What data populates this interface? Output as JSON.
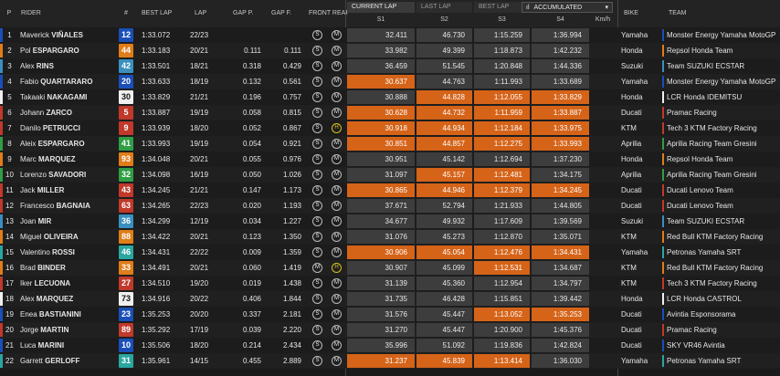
{
  "headers": {
    "pos": "P",
    "rider": "RIDER",
    "num": "#",
    "best": "BEST LAP",
    "lap": "LAP",
    "gapp": "GAP P.",
    "gapf": "GAP F.",
    "tyres": "FRONT REAR",
    "bike": "BIKE",
    "team": "TEAM"
  },
  "sector_tabs": {
    "current": "CURRENT LAP",
    "last": "LAST LAP",
    "best": "BEST LAP",
    "mode": "ACCUMULATED",
    "mode_prefix": "ıl"
  },
  "sector_labels": {
    "s1": "S1",
    "s2": "S2",
    "s3": "S3",
    "s4": "S4",
    "speed": "Km/h"
  },
  "rows": [
    {
      "pos": "1",
      "first": "Maverick",
      "last": "VIÑALES",
      "num": "12",
      "num_bg": "#1a4fb8",
      "num_fg": "#ffffff",
      "strip": "#1a4fb8",
      "best": "1:33.072",
      "lap": "22/23",
      "gapp": "",
      "gapf": "",
      "front": "S",
      "rear": "M",
      "s1": "32.411",
      "s2": "46.730",
      "s3": "1:15.259",
      "s4": "1:36.994",
      "o": [
        0,
        0,
        0,
        0
      ],
      "bike": "Yamaha",
      "team": "Monster Energy Yamaha MotoGP",
      "team_color": "#1a4fb8"
    },
    {
      "pos": "2",
      "first": "Pol",
      "last": "ESPARGARO",
      "num": "44",
      "num_bg": "#e07d18",
      "num_fg": "#ffffff",
      "strip": "#e07d18",
      "best": "1:33.183",
      "lap": "20/21",
      "gapp": "0.111",
      "gapf": "0.111",
      "front": "S",
      "rear": "M",
      "s1": "33.982",
      "s2": "49.399",
      "s3": "1:18.873",
      "s4": "1:42.232",
      "o": [
        0,
        0,
        0,
        0
      ],
      "bike": "Honda",
      "team": "Repsol Honda Team",
      "team_color": "#e07d18"
    },
    {
      "pos": "3",
      "first": "Alex",
      "last": "RINS",
      "num": "42",
      "num_bg": "#3a8fbf",
      "num_fg": "#ffffff",
      "strip": "#3a8fbf",
      "best": "1:33.501",
      "lap": "18/21",
      "gapp": "0.318",
      "gapf": "0.429",
      "front": "S",
      "rear": "M",
      "s1": "36.459",
      "s2": "51.545",
      "s3": "1:20.848",
      "s4": "1:44.336",
      "o": [
        0,
        0,
        0,
        0
      ],
      "bike": "Suzuki",
      "team": "Team SUZUKI ECSTAR",
      "team_color": "#3a8fbf"
    },
    {
      "pos": "4",
      "first": "Fabio",
      "last": "QUARTARARO",
      "num": "20",
      "num_bg": "#1a4fb8",
      "num_fg": "#ffffff",
      "strip": "#1a4fb8",
      "best": "1:33.633",
      "lap": "18/19",
      "gapp": "0.132",
      "gapf": "0.561",
      "front": "S",
      "rear": "M",
      "s1": "30.637",
      "s2": "44.763",
      "s3": "1:11.993",
      "s4": "1:33.689",
      "o": [
        1,
        0,
        0,
        0
      ],
      "bike": "Yamaha",
      "team": "Monster Energy Yamaha MotoGP",
      "team_color": "#1a4fb8"
    },
    {
      "pos": "5",
      "first": "Takaaki",
      "last": "NAKAGAMI",
      "num": "30",
      "num_bg": "#f0f0f0",
      "num_fg": "#111111",
      "strip": "#f0f0f0",
      "best": "1:33.829",
      "lap": "21/21",
      "gapp": "0.196",
      "gapf": "0.757",
      "front": "S",
      "rear": "M",
      "s1": "30.888",
      "s2": "44.828",
      "s3": "1:12.055",
      "s4": "1:33.829",
      "o": [
        0,
        1,
        1,
        1
      ],
      "bike": "Honda",
      "team": "LCR Honda IDEMITSU",
      "team_color": "#f0f0f0"
    },
    {
      "pos": "6",
      "first": "Johann",
      "last": "ZARCO",
      "num": "5",
      "num_bg": "#c0392b",
      "num_fg": "#ffffff",
      "strip": "#c0392b",
      "best": "1:33.887",
      "lap": "19/19",
      "gapp": "0.058",
      "gapf": "0.815",
      "front": "S",
      "rear": "M",
      "s1": "30.628",
      "s2": "44.732",
      "s3": "1:11.959",
      "s4": "1:33.887",
      "o": [
        1,
        1,
        1,
        1
      ],
      "bike": "Ducati",
      "team": "Pramac Racing",
      "team_color": "#c0392b"
    },
    {
      "pos": "7",
      "first": "Danilo",
      "last": "PETRUCCI",
      "num": "9",
      "num_bg": "#c0392b",
      "num_fg": "#ffffff",
      "strip": "#c0392b",
      "best": "1:33.939",
      "lap": "18/20",
      "gapp": "0.052",
      "gapf": "0.867",
      "front": "S",
      "rear": "H",
      "s1": "30.918",
      "s2": "44.934",
      "s3": "1:12.184",
      "s4": "1:33.975",
      "o": [
        1,
        1,
        1,
        1
      ],
      "bike": "KTM",
      "team": "Tech 3 KTM Factory Racing",
      "team_color": "#c0392b"
    },
    {
      "pos": "8",
      "first": "Aleix",
      "last": "ESPARGARO",
      "num": "41",
      "num_bg": "#2f9e44",
      "num_fg": "#ffffff",
      "strip": "#2f9e44",
      "best": "1:33.993",
      "lap": "19/19",
      "gapp": "0.054",
      "gapf": "0.921",
      "front": "S",
      "rear": "M",
      "s1": "30.851",
      "s2": "44.857",
      "s3": "1:12.275",
      "s4": "1:33.993",
      "o": [
        1,
        1,
        1,
        1
      ],
      "bike": "Aprilia",
      "team": "Aprilia Racing Team Gresini",
      "team_color": "#2f9e44"
    },
    {
      "pos": "9",
      "first": "Marc",
      "last": "MARQUEZ",
      "num": "93",
      "num_bg": "#e07d18",
      "num_fg": "#ffffff",
      "strip": "#e07d18",
      "best": "1:34.048",
      "lap": "20/21",
      "gapp": "0.055",
      "gapf": "0.976",
      "front": "S",
      "rear": "M",
      "s1": "30.951",
      "s2": "45.142",
      "s3": "1:12.694",
      "s4": "1:37.230",
      "o": [
        0,
        0,
        0,
        0
      ],
      "bike": "Honda",
      "team": "Repsol Honda Team",
      "team_color": "#e07d18"
    },
    {
      "pos": "10",
      "first": "Lorenzo",
      "last": "SAVADORI",
      "num": "32",
      "num_bg": "#2f9e44",
      "num_fg": "#ffffff",
      "strip": "#2f9e44",
      "best": "1:34.098",
      "lap": "16/19",
      "gapp": "0.050",
      "gapf": "1.026",
      "front": "S",
      "rear": "M",
      "s1": "31.097",
      "s2": "45.157",
      "s3": "1:12.481",
      "s4": "1:34.175",
      "o": [
        0,
        1,
        1,
        0
      ],
      "bike": "Aprilia",
      "team": "Aprilia Racing Team Gresini",
      "team_color": "#2f9e44"
    },
    {
      "pos": "11",
      "first": "Jack",
      "last": "MILLER",
      "num": "43",
      "num_bg": "#c0392b",
      "num_fg": "#ffffff",
      "strip": "#c0392b",
      "best": "1:34.245",
      "lap": "21/21",
      "gapp": "0.147",
      "gapf": "1.173",
      "front": "S",
      "rear": "M",
      "s1": "30.865",
      "s2": "44.946",
      "s3": "1:12.379",
      "s4": "1:34.245",
      "o": [
        1,
        1,
        1,
        1
      ],
      "bike": "Ducati",
      "team": "Ducati Lenovo Team",
      "team_color": "#c0392b"
    },
    {
      "pos": "12",
      "first": "Francesco",
      "last": "BAGNAIA",
      "num": "63",
      "num_bg": "#c0392b",
      "num_fg": "#ffffff",
      "strip": "#c0392b",
      "best": "1:34.265",
      "lap": "22/23",
      "gapp": "0.020",
      "gapf": "1.193",
      "front": "S",
      "rear": "M",
      "s1": "37.671",
      "s2": "52.794",
      "s3": "1:21.933",
      "s4": "1:44.805",
      "o": [
        0,
        0,
        0,
        0
      ],
      "bike": "Ducati",
      "team": "Ducati Lenovo Team",
      "team_color": "#c0392b"
    },
    {
      "pos": "13",
      "first": "Joan",
      "last": "MIR",
      "num": "36",
      "num_bg": "#3a8fbf",
      "num_fg": "#ffffff",
      "strip": "#3a8fbf",
      "best": "1:34.299",
      "lap": "12/19",
      "gapp": "0.034",
      "gapf": "1.227",
      "front": "S",
      "rear": "M",
      "s1": "34.677",
      "s2": "49.932",
      "s3": "1:17.609",
      "s4": "1:39.569",
      "o": [
        0,
        0,
        0,
        0
      ],
      "bike": "Suzuki",
      "team": "Team SUZUKI ECSTAR",
      "team_color": "#3a8fbf"
    },
    {
      "pos": "14",
      "first": "Miguel",
      "last": "OLIVEIRA",
      "num": "88",
      "num_bg": "#e07d18",
      "num_fg": "#ffffff",
      "strip": "#e07d18",
      "best": "1:34.422",
      "lap": "20/21",
      "gapp": "0.123",
      "gapf": "1.350",
      "front": "S",
      "rear": "M",
      "s1": "31.076",
      "s2": "45.273",
      "s3": "1:12.870",
      "s4": "1:35.071",
      "o": [
        0,
        0,
        0,
        0
      ],
      "bike": "KTM",
      "team": "Red Bull KTM Factory Racing",
      "team_color": "#e07d18"
    },
    {
      "pos": "15",
      "first": "Valentino",
      "last": "ROSSI",
      "num": "46",
      "num_bg": "#2aa6a0",
      "num_fg": "#ffffff",
      "strip": "#2aa6a0",
      "best": "1:34.431",
      "lap": "22/22",
      "gapp": "0.009",
      "gapf": "1.359",
      "front": "S",
      "rear": "M",
      "s1": "30.906",
      "s2": "45.054",
      "s3": "1:12.476",
      "s4": "1:34.431",
      "o": [
        1,
        1,
        1,
        1
      ],
      "bike": "Yamaha",
      "team": "Petronas Yamaha SRT",
      "team_color": "#2aa6a0"
    },
    {
      "pos": "16",
      "first": "Brad",
      "last": "BINDER",
      "num": "33",
      "num_bg": "#e07d18",
      "num_fg": "#ffffff",
      "strip": "#e07d18",
      "best": "1:34.491",
      "lap": "20/21",
      "gapp": "0.060",
      "gapf": "1.419",
      "front": "M",
      "rear": "H",
      "s1": "30.907",
      "s2": "45.099",
      "s3": "1:12.531",
      "s4": "1:34.687",
      "o": [
        0,
        0,
        1,
        0
      ],
      "bike": "KTM",
      "team": "Red Bull KTM Factory Racing",
      "team_color": "#e07d18"
    },
    {
      "pos": "17",
      "first": "Iker",
      "last": "LECUONA",
      "num": "27",
      "num_bg": "#c0392b",
      "num_fg": "#ffffff",
      "strip": "#c0392b",
      "best": "1:34.510",
      "lap": "19/20",
      "gapp": "0.019",
      "gapf": "1.438",
      "front": "S",
      "rear": "M",
      "s1": "31.139",
      "s2": "45.360",
      "s3": "1:12.954",
      "s4": "1:34.797",
      "o": [
        0,
        0,
        0,
        0
      ],
      "bike": "KTM",
      "team": "Tech 3 KTM Factory Racing",
      "team_color": "#c0392b"
    },
    {
      "pos": "18",
      "first": "Alex",
      "last": "MARQUEZ",
      "num": "73",
      "num_bg": "#f0f0f0",
      "num_fg": "#111111",
      "strip": "#f0f0f0",
      "best": "1:34.916",
      "lap": "20/22",
      "gapp": "0.406",
      "gapf": "1.844",
      "front": "S",
      "rear": "M",
      "s1": "31.735",
      "s2": "46.428",
      "s3": "1:15.851",
      "s4": "1:39.442",
      "o": [
        0,
        0,
        0,
        0
      ],
      "bike": "Honda",
      "team": "LCR Honda CASTROL",
      "team_color": "#f0f0f0"
    },
    {
      "pos": "19",
      "first": "Enea",
      "last": "BASTIANINI",
      "num": "23",
      "num_bg": "#1a4fb8",
      "num_fg": "#ffffff",
      "strip": "#1a4fb8",
      "best": "1:35.253",
      "lap": "20/20",
      "gapp": "0.337",
      "gapf": "2.181",
      "front": "S",
      "rear": "M",
      "s1": "31.576",
      "s2": "45.447",
      "s3": "1:13.052",
      "s4": "1:35.253",
      "o": [
        0,
        0,
        1,
        1
      ],
      "bike": "Ducati",
      "team": "Avintia Esponsorama",
      "team_color": "#1a4fb8"
    },
    {
      "pos": "20",
      "first": "Jorge",
      "last": "MARTIN",
      "num": "89",
      "num_bg": "#c0392b",
      "num_fg": "#ffffff",
      "strip": "#c0392b",
      "best": "1:35.292",
      "lap": "17/19",
      "gapp": "0.039",
      "gapf": "2.220",
      "front": "S",
      "rear": "M",
      "s1": "31.270",
      "s2": "45.447",
      "s3": "1:20.900",
      "s4": "1:45.376",
      "o": [
        0,
        0,
        0,
        0
      ],
      "bike": "Ducati",
      "team": "Pramac Racing",
      "team_color": "#c0392b"
    },
    {
      "pos": "21",
      "first": "Luca",
      "last": "MARINI",
      "num": "10",
      "num_bg": "#1a4fb8",
      "num_fg": "#ffffff",
      "strip": "#1a4fb8",
      "best": "1:35.506",
      "lap": "18/20",
      "gapp": "0.214",
      "gapf": "2.434",
      "front": "S",
      "rear": "M",
      "s1": "35.996",
      "s2": "51.092",
      "s3": "1:19.836",
      "s4": "1:42.824",
      "o": [
        0,
        0,
        0,
        0
      ],
      "bike": "Ducati",
      "team": "SKY VR46 Avintia",
      "team_color": "#1a4fb8"
    },
    {
      "pos": "22",
      "first": "Garrett",
      "last": "GERLOFF",
      "num": "31",
      "num_bg": "#2aa6a0",
      "num_fg": "#ffffff",
      "strip": "#2aa6a0",
      "best": "1:35.961",
      "lap": "14/15",
      "gapp": "0.455",
      "gapf": "2.889",
      "front": "S",
      "rear": "M",
      "s1": "31.237",
      "s2": "45.839",
      "s3": "1:13.414",
      "s4": "1:36.030",
      "o": [
        1,
        1,
        1,
        0
      ],
      "bike": "Yamaha",
      "team": "Petronas Yamaha SRT",
      "team_color": "#2aa6a0"
    }
  ]
}
